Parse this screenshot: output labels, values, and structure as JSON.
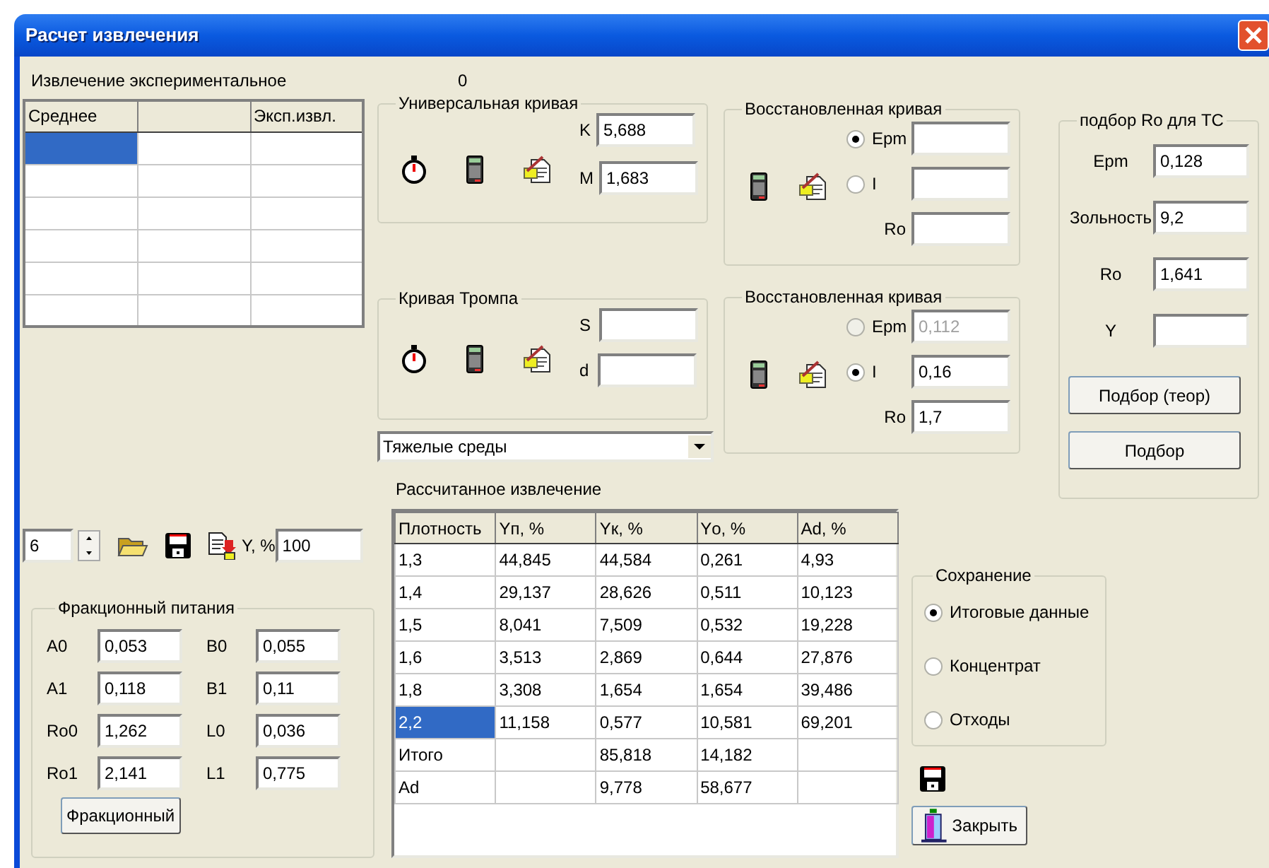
{
  "window": {
    "title": "Расчет извлечения"
  },
  "experimental": {
    "label": "Извлечение экспериментальное",
    "counter": "0",
    "column_1": "Среднее",
    "column_3": "Эксп.извл.",
    "rows": [
      {
        "selected": true
      },
      {
        "selected": false
      },
      {
        "selected": false
      },
      {
        "selected": false
      },
      {
        "selected": false
      },
      {
        "selected": false
      }
    ]
  },
  "universal_curve": {
    "title": "Универсальная кривая",
    "fields": [
      {
        "label": "K",
        "value": "5,688"
      },
      {
        "label": "M",
        "value": "1,683"
      }
    ]
  },
  "restored_curve_1": {
    "title": "Восстановленная кривая",
    "options": [
      {
        "label": "Epm",
        "selected": true,
        "disabled": false
      },
      {
        "label": "I",
        "selected": false,
        "disabled": false
      }
    ],
    "ro": {
      "label": "Ro"
    }
  },
  "tromp_curve": {
    "title": "Кривая Тромпа",
    "fields": [
      {
        "label": "S"
      },
      {
        "label": "d"
      }
    ]
  },
  "restored_curve_2": {
    "title": "Восстановленная кривая",
    "options": [
      {
        "label": "Epm",
        "selected": false,
        "disabled": true,
        "value": "0,112"
      },
      {
        "label": "I",
        "selected": true,
        "disabled": false,
        "value": "0,16"
      }
    ],
    "ro": {
      "label": "Ro",
      "value": "1,7"
    }
  },
  "medium_select": {
    "value": "Тяжелые среды"
  },
  "ro_fit": {
    "title": "подбор Ro для ТС",
    "fields": [
      {
        "label": "Epm",
        "value": "0,128"
      },
      {
        "label": "Зольность",
        "value": "9,2"
      },
      {
        "label": "Ro",
        "value": "1,641"
      },
      {
        "label": "Y"
      }
    ],
    "buttons": [
      "Подбор (теор)",
      "Подбор"
    ]
  },
  "toolbar": {
    "count": "6",
    "y_label": "Y, %",
    "y_value": "100"
  },
  "fraction_feed": {
    "title": "Фракционный питания",
    "fields": [
      {
        "label": "A0",
        "value": "0,053"
      },
      {
        "label": "B0",
        "value": "0,055"
      },
      {
        "label": "A1",
        "value": "0,118"
      },
      {
        "label": "B1",
        "value": "0,11"
      },
      {
        "label": "Ro0",
        "value": "1,262"
      },
      {
        "label": "L0",
        "value": "0,036"
      },
      {
        "label": "Ro1",
        "value": "2,141"
      },
      {
        "label": "L1",
        "value": "0,775"
      }
    ],
    "button": "Фракционный"
  },
  "calculated": {
    "label": "Рассчитанное извлечение",
    "columns": [
      "Плотность",
      "Yп, %",
      "Yк, %",
      "Yо, %",
      "Ad, %"
    ],
    "rows": [
      {
        "selected": false,
        "cells": [
          "1,3",
          "44,845",
          "44,584",
          "0,261",
          "4,93"
        ]
      },
      {
        "selected": false,
        "cells": [
          "1,4",
          "29,137",
          "28,626",
          "0,511",
          "10,123"
        ]
      },
      {
        "selected": false,
        "cells": [
          "1,5",
          "8,041",
          "7,509",
          "0,532",
          "19,228"
        ]
      },
      {
        "selected": false,
        "cells": [
          "1,6",
          "3,513",
          "2,869",
          "0,644",
          "27,876"
        ]
      },
      {
        "selected": false,
        "cells": [
          "1,8",
          "3,308",
          "1,654",
          "1,654",
          "39,486"
        ]
      },
      {
        "selected": true,
        "cells": [
          "2,2",
          "11,158",
          "0,577",
          "10,581",
          "69,201"
        ]
      },
      {
        "selected": false,
        "cells": [
          "Итого",
          null,
          "85,818",
          "14,182",
          null
        ]
      },
      {
        "selected": false,
        "cells": [
          "Ad",
          null,
          "9,778",
          "58,677",
          null
        ]
      }
    ]
  },
  "saving": {
    "title": "Сохранение",
    "options": [
      {
        "label": "Итоговые данные",
        "selected": true
      },
      {
        "label": "Концентрат",
        "selected": false
      },
      {
        "label": "Отходы",
        "selected": false
      }
    ]
  },
  "close_button": {
    "label": "Закрыть"
  }
}
